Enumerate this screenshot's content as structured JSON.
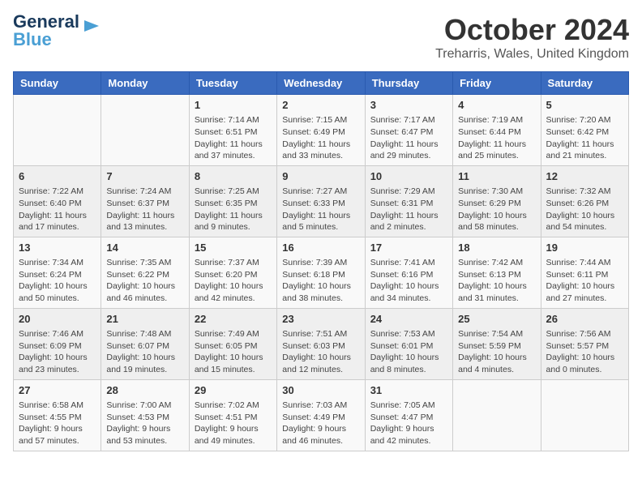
{
  "logo": {
    "line1": "General",
    "line2": "Blue"
  },
  "title": "October 2024",
  "location": "Treharris, Wales, United Kingdom",
  "days_of_week": [
    "Sunday",
    "Monday",
    "Tuesday",
    "Wednesday",
    "Thursday",
    "Friday",
    "Saturday"
  ],
  "weeks": [
    [
      {
        "day": "",
        "content": ""
      },
      {
        "day": "",
        "content": ""
      },
      {
        "day": "1",
        "content": "Sunrise: 7:14 AM\nSunset: 6:51 PM\nDaylight: 11 hours and 37 minutes."
      },
      {
        "day": "2",
        "content": "Sunrise: 7:15 AM\nSunset: 6:49 PM\nDaylight: 11 hours and 33 minutes."
      },
      {
        "day": "3",
        "content": "Sunrise: 7:17 AM\nSunset: 6:47 PM\nDaylight: 11 hours and 29 minutes."
      },
      {
        "day": "4",
        "content": "Sunrise: 7:19 AM\nSunset: 6:44 PM\nDaylight: 11 hours and 25 minutes."
      },
      {
        "day": "5",
        "content": "Sunrise: 7:20 AM\nSunset: 6:42 PM\nDaylight: 11 hours and 21 minutes."
      }
    ],
    [
      {
        "day": "6",
        "content": "Sunrise: 7:22 AM\nSunset: 6:40 PM\nDaylight: 11 hours and 17 minutes."
      },
      {
        "day": "7",
        "content": "Sunrise: 7:24 AM\nSunset: 6:37 PM\nDaylight: 11 hours and 13 minutes."
      },
      {
        "day": "8",
        "content": "Sunrise: 7:25 AM\nSunset: 6:35 PM\nDaylight: 11 hours and 9 minutes."
      },
      {
        "day": "9",
        "content": "Sunrise: 7:27 AM\nSunset: 6:33 PM\nDaylight: 11 hours and 5 minutes."
      },
      {
        "day": "10",
        "content": "Sunrise: 7:29 AM\nSunset: 6:31 PM\nDaylight: 11 hours and 2 minutes."
      },
      {
        "day": "11",
        "content": "Sunrise: 7:30 AM\nSunset: 6:29 PM\nDaylight: 10 hours and 58 minutes."
      },
      {
        "day": "12",
        "content": "Sunrise: 7:32 AM\nSunset: 6:26 PM\nDaylight: 10 hours and 54 minutes."
      }
    ],
    [
      {
        "day": "13",
        "content": "Sunrise: 7:34 AM\nSunset: 6:24 PM\nDaylight: 10 hours and 50 minutes."
      },
      {
        "day": "14",
        "content": "Sunrise: 7:35 AM\nSunset: 6:22 PM\nDaylight: 10 hours and 46 minutes."
      },
      {
        "day": "15",
        "content": "Sunrise: 7:37 AM\nSunset: 6:20 PM\nDaylight: 10 hours and 42 minutes."
      },
      {
        "day": "16",
        "content": "Sunrise: 7:39 AM\nSunset: 6:18 PM\nDaylight: 10 hours and 38 minutes."
      },
      {
        "day": "17",
        "content": "Sunrise: 7:41 AM\nSunset: 6:16 PM\nDaylight: 10 hours and 34 minutes."
      },
      {
        "day": "18",
        "content": "Sunrise: 7:42 AM\nSunset: 6:13 PM\nDaylight: 10 hours and 31 minutes."
      },
      {
        "day": "19",
        "content": "Sunrise: 7:44 AM\nSunset: 6:11 PM\nDaylight: 10 hours and 27 minutes."
      }
    ],
    [
      {
        "day": "20",
        "content": "Sunrise: 7:46 AM\nSunset: 6:09 PM\nDaylight: 10 hours and 23 minutes."
      },
      {
        "day": "21",
        "content": "Sunrise: 7:48 AM\nSunset: 6:07 PM\nDaylight: 10 hours and 19 minutes."
      },
      {
        "day": "22",
        "content": "Sunrise: 7:49 AM\nSunset: 6:05 PM\nDaylight: 10 hours and 15 minutes."
      },
      {
        "day": "23",
        "content": "Sunrise: 7:51 AM\nSunset: 6:03 PM\nDaylight: 10 hours and 12 minutes."
      },
      {
        "day": "24",
        "content": "Sunrise: 7:53 AM\nSunset: 6:01 PM\nDaylight: 10 hours and 8 minutes."
      },
      {
        "day": "25",
        "content": "Sunrise: 7:54 AM\nSunset: 5:59 PM\nDaylight: 10 hours and 4 minutes."
      },
      {
        "day": "26",
        "content": "Sunrise: 7:56 AM\nSunset: 5:57 PM\nDaylight: 10 hours and 0 minutes."
      }
    ],
    [
      {
        "day": "27",
        "content": "Sunrise: 6:58 AM\nSunset: 4:55 PM\nDaylight: 9 hours and 57 minutes."
      },
      {
        "day": "28",
        "content": "Sunrise: 7:00 AM\nSunset: 4:53 PM\nDaylight: 9 hours and 53 minutes."
      },
      {
        "day": "29",
        "content": "Sunrise: 7:02 AM\nSunset: 4:51 PM\nDaylight: 9 hours and 49 minutes."
      },
      {
        "day": "30",
        "content": "Sunrise: 7:03 AM\nSunset: 4:49 PM\nDaylight: 9 hours and 46 minutes."
      },
      {
        "day": "31",
        "content": "Sunrise: 7:05 AM\nSunset: 4:47 PM\nDaylight: 9 hours and 42 minutes."
      },
      {
        "day": "",
        "content": ""
      },
      {
        "day": "",
        "content": ""
      }
    ]
  ]
}
